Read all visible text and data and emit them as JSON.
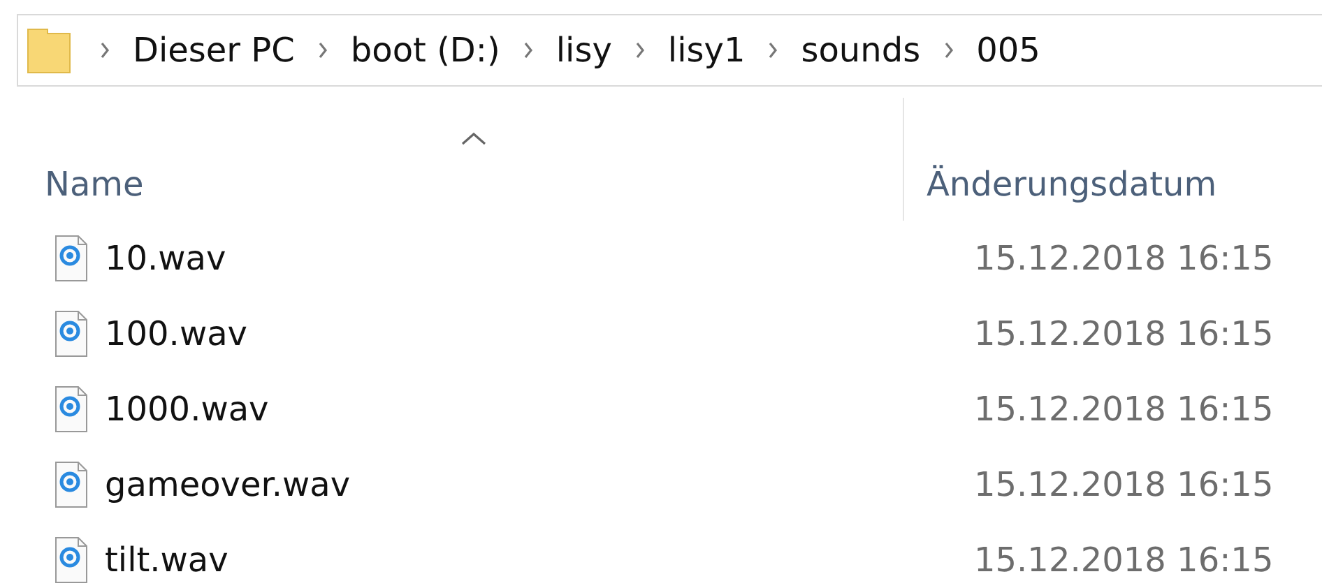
{
  "address_bar": {
    "crumbs": [
      "Dieser PC",
      "boot (D:)",
      "lisy",
      "lisy1",
      "sounds",
      "005"
    ]
  },
  "columns": [
    {
      "label": "Name",
      "sorted": true
    },
    {
      "label": "Änderungsdatum",
      "sorted": false
    }
  ],
  "files": [
    {
      "name": "10.wav",
      "modified": "15.12.2018 16:15"
    },
    {
      "name": "100.wav",
      "modified": "15.12.2018 16:15"
    },
    {
      "name": "1000.wav",
      "modified": "15.12.2018 16:15"
    },
    {
      "name": "gameover.wav",
      "modified": "15.12.2018 16:15"
    },
    {
      "name": "tilt.wav",
      "modified": "15.12.2018 16:15"
    }
  ]
}
